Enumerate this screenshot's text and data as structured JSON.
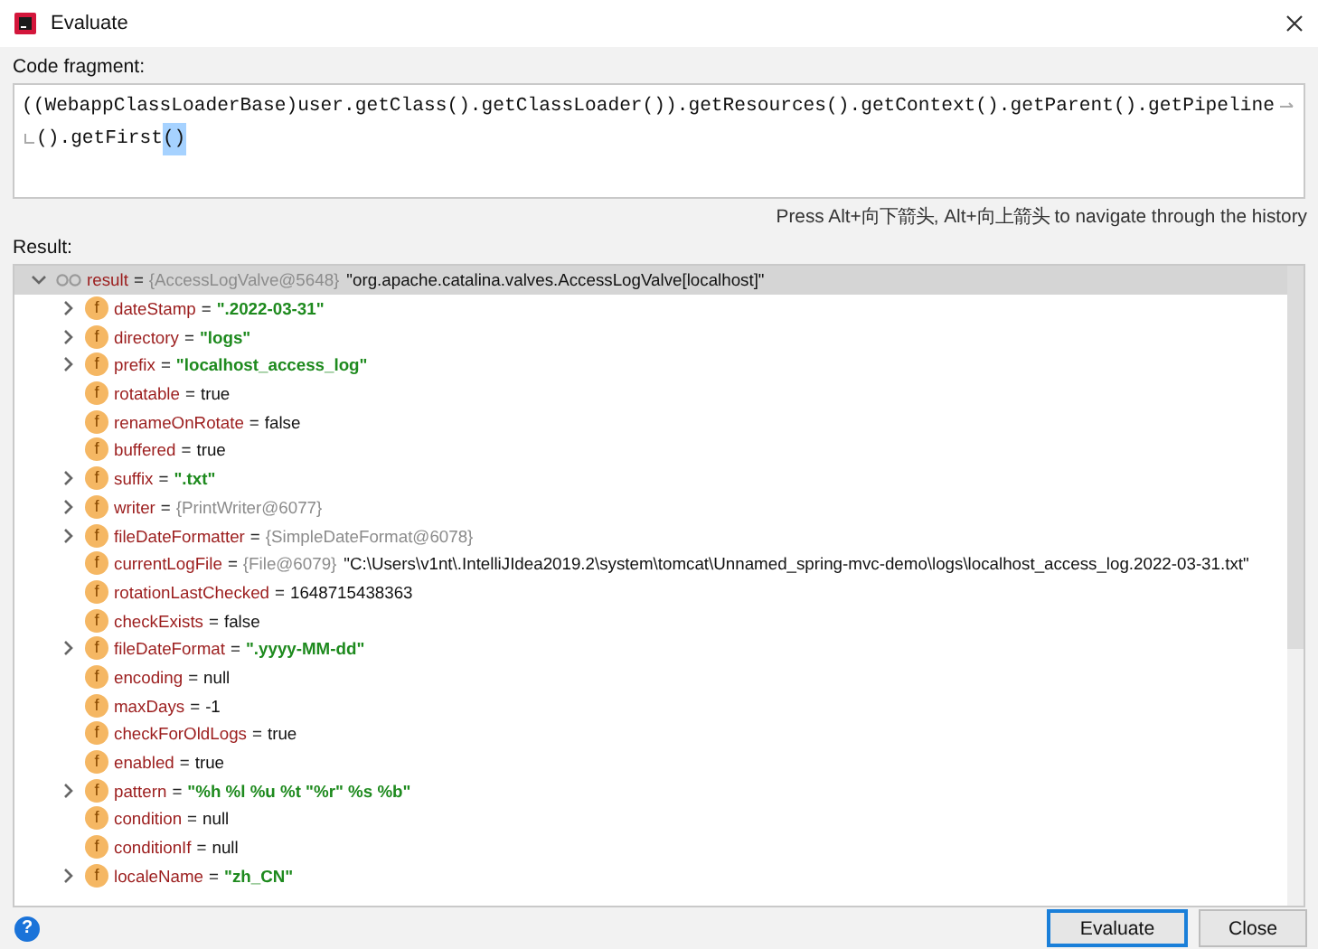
{
  "window": {
    "title": "Evaluate"
  },
  "code_fragment": {
    "label": "Code fragment:",
    "lines": [
      [
        {
          "text": "((WebappClassLoaderBase)user.getClass().getClassLoader()).getResources().getContext().getParent().getPipeline",
          "selected": false
        }
      ],
      [
        {
          "text": "().getFirst",
          "selected": false
        },
        {
          "text": "()",
          "selected": true
        }
      ]
    ]
  },
  "hint": "Press Alt+向下箭头, Alt+向上箭头 to navigate through the history",
  "result": {
    "label": "Result:",
    "root": {
      "name": "result",
      "sep": "=",
      "ref": "{AccessLogValve@5648}",
      "value": "\"org.apache.catalina.valves.AccessLogValve[localhost]\"",
      "kind": "plain",
      "expandable": true,
      "expanded": true,
      "selected": true,
      "children": [
        {
          "icon": "f",
          "name": "dateStamp",
          "sep": "=",
          "value": "\".2022-03-31\"",
          "kind": "string",
          "expandable": true,
          "expanded": false
        },
        {
          "icon": "f",
          "name": "directory",
          "sep": "=",
          "value": "\"logs\"",
          "kind": "string",
          "expandable": true,
          "expanded": false
        },
        {
          "icon": "f",
          "name": "prefix",
          "sep": "=",
          "value": "\"localhost_access_log\"",
          "kind": "string",
          "expandable": true,
          "expanded": false
        },
        {
          "icon": "f",
          "name": "rotatable",
          "sep": "=",
          "value": "true",
          "kind": "plain",
          "expandable": false
        },
        {
          "icon": "f",
          "name": "renameOnRotate",
          "sep": "=",
          "value": "false",
          "kind": "plain",
          "expandable": false
        },
        {
          "icon": "f",
          "name": "buffered",
          "sep": "=",
          "value": "true",
          "kind": "plain",
          "expandable": false
        },
        {
          "icon": "f",
          "name": "suffix",
          "sep": "=",
          "value": "\".txt\"",
          "kind": "string",
          "expandable": true,
          "expanded": false
        },
        {
          "icon": "f",
          "name": "writer",
          "sep": "=",
          "ref": "{PrintWriter@6077}",
          "expandable": true,
          "expanded": false
        },
        {
          "icon": "f",
          "name": "fileDateFormatter",
          "sep": "=",
          "ref": "{SimpleDateFormat@6078}",
          "expandable": true,
          "expanded": false
        },
        {
          "icon": "f",
          "name": "currentLogFile",
          "sep": "=",
          "ref": "{File@6079}",
          "value": "\"C:\\Users\\v1nt\\.IntelliJIdea2019.2\\system\\tomcat\\Unnamed_spring-mvc-demo\\logs\\localhost_access_log.2022-03-31.txt\"",
          "kind": "plain",
          "expandable": false
        },
        {
          "icon": "f",
          "name": "rotationLastChecked",
          "sep": "=",
          "value": "1648715438363",
          "kind": "plain",
          "expandable": false
        },
        {
          "icon": "f",
          "name": "checkExists",
          "sep": "=",
          "value": "false",
          "kind": "plain",
          "expandable": false
        },
        {
          "icon": "f",
          "name": "fileDateFormat",
          "sep": "=",
          "value": "\".yyyy-MM-dd\"",
          "kind": "string",
          "expandable": true,
          "expanded": false
        },
        {
          "icon": "f",
          "name": "encoding",
          "sep": "=",
          "value": "null",
          "kind": "plain",
          "expandable": false
        },
        {
          "icon": "f",
          "name": "maxDays",
          "sep": "=",
          "value": "-1",
          "kind": "plain",
          "expandable": false
        },
        {
          "icon": "f",
          "name": "checkForOldLogs",
          "sep": "=",
          "value": "true",
          "kind": "plain",
          "expandable": false
        },
        {
          "icon": "f",
          "name": "enabled",
          "sep": "=",
          "value": "true",
          "kind": "plain",
          "expandable": false
        },
        {
          "icon": "f",
          "name": "pattern",
          "sep": "=",
          "value": "\"%h %l %u %t \"%r\" %s %b\"",
          "kind": "string",
          "expandable": true,
          "expanded": false
        },
        {
          "icon": "f",
          "name": "condition",
          "sep": "=",
          "value": "null",
          "kind": "plain",
          "expandable": false
        },
        {
          "icon": "f",
          "name": "conditionIf",
          "sep": "=",
          "value": "null",
          "kind": "plain",
          "expandable": false
        },
        {
          "icon": "f",
          "name": "localeName",
          "sep": "=",
          "value": "\"zh_CN\"",
          "kind": "string",
          "expandable": true,
          "expanded": false
        }
      ]
    }
  },
  "help_button": "?",
  "buttons": [
    {
      "label": "Evaluate",
      "default": true
    },
    {
      "label": "Close",
      "default": false
    }
  ]
}
